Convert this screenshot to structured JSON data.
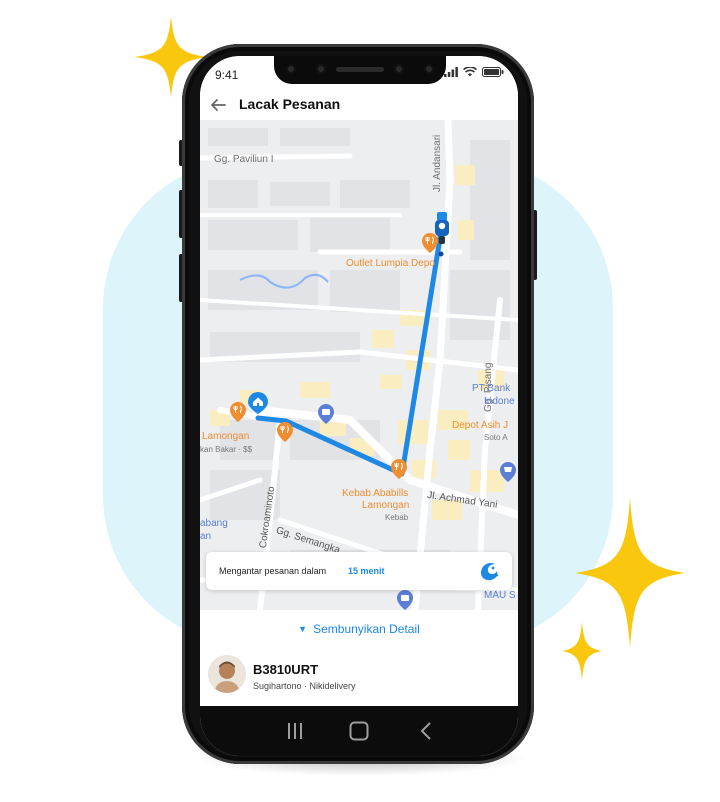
{
  "status_bar": {
    "time": "9:41"
  },
  "app_bar": {
    "title": "Lacak Pesanan",
    "back_icon": "arrow-left-icon"
  },
  "map": {
    "streets": [
      "Gg. Paviliun I",
      "Jl. Andansari",
      "Gg. Pisang",
      "Jl. Achmad Yani",
      "Jl. Cokroaminoto",
      "Gg. Semangka"
    ],
    "places": [
      {
        "name": "Outlet Lumpia Depo",
        "kind": "restaurant"
      },
      {
        "name": "Lamongan",
        "kind": "restaurant"
      },
      {
        "name": "kan Bakar · $$",
        "kind": "restaurant-sub"
      },
      {
        "name": "Kebab Ababills",
        "kind": "restaurant"
      },
      {
        "name": "Lamongan",
        "kind": "restaurant"
      },
      {
        "name": "Kebab",
        "kind": "restaurant-sub"
      },
      {
        "name": "PT Bank",
        "kind": "poi"
      },
      {
        "name": "Indone",
        "kind": "poi"
      },
      {
        "name": "Depot Asih J",
        "kind": "restaurant"
      },
      {
        "name": "Soto A",
        "kind": "restaurant-sub"
      },
      {
        "name": "abang",
        "kind": "poi"
      },
      {
        "name": "an",
        "kind": "poi"
      },
      {
        "name": "MAU S",
        "kind": "poi"
      }
    ],
    "colors": {
      "route": "#1e88e5",
      "restaurant": "#ef8d2f",
      "poi": "#5b7fd6"
    }
  },
  "eta": {
    "label": "Mengantar pesanan dalam",
    "time": "15 menit",
    "logo_icon": "nikidelivery-logo-icon"
  },
  "sheet": {
    "toggle_label": "Sembunyikan Detail",
    "toggle_icon": "caret-down-icon",
    "plate": "B3810URT",
    "driver_info": "Sugihartono · Nikidelivery"
  },
  "nav_bar": {
    "recent_icon": "recent-apps-icon",
    "home_icon": "home-icon",
    "back_icon": "back-chevron-icon"
  },
  "colors": {
    "accent": "#1e88e5",
    "sparkle": "#f9c80e",
    "blob": "#def4fb"
  }
}
